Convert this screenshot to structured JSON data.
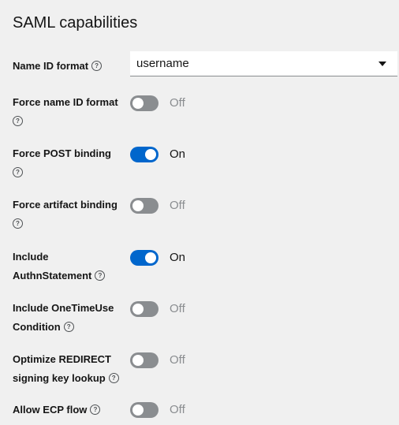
{
  "section": {
    "title": "SAML capabilities"
  },
  "name_id_format": {
    "label": "Name ID format",
    "help": "?",
    "value": "username"
  },
  "settings": [
    {
      "label_line1": "Force name ID format",
      "label_line2": "",
      "state": "Off"
    },
    {
      "label_line1": "Force POST binding",
      "label_line2": "",
      "state": "On"
    },
    {
      "label_line1": "Force artifact binding",
      "label_line2": "",
      "state": "Off"
    },
    {
      "label_line1": "Include",
      "label_line2": "AuthnStatement",
      "state": "On"
    },
    {
      "label_line1": "Include OneTimeUse",
      "label_line2": "Condition",
      "state": "Off"
    },
    {
      "label_line1": "Optimize REDIRECT",
      "label_line2": "signing key lookup",
      "state": "Off"
    },
    {
      "label_line1": "Allow ECP flow",
      "label_line2": "",
      "state": "Off"
    }
  ],
  "help_glyph": "?",
  "colors": {
    "toggle_on": "#0066cc",
    "toggle_off": "#8a8d90",
    "background": "#f0f0f0"
  }
}
